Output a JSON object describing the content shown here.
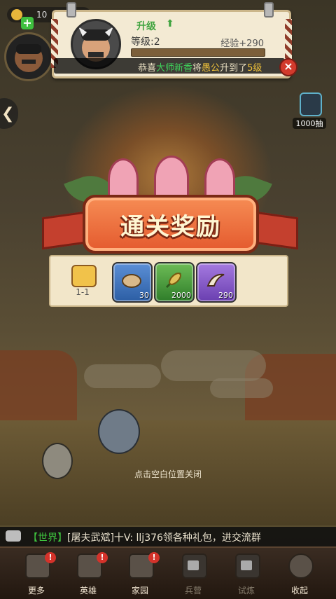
{
  "hud": {
    "resource_value": "10",
    "plus": "+"
  },
  "notice": {
    "title": "升级",
    "level": "等级:2",
    "exp": "经验+290",
    "ticker": {
      "prefix": "恭喜",
      "name": "大师新香",
      "mid": "将",
      "hero": "愚公",
      "suffix": "升到了",
      "level_part": "5级"
    },
    "close": "×"
  },
  "banner": {
    "title": "通关奖励"
  },
  "rewards": {
    "stage_label": "1-1",
    "items": [
      {
        "icon": "stone-icon",
        "count": "30",
        "color": "blue"
      },
      {
        "icon": "grain-icon",
        "count": "2000",
        "color": "green"
      },
      {
        "icon": "horn-icon",
        "count": "290",
        "color": "purple"
      }
    ]
  },
  "draw_button": {
    "label": "1000抽"
  },
  "hint": "点击空白位置关闭",
  "chat": {
    "channel": "【世界】",
    "message": "[屠夫武斌]十V: llj376领各种礼包，进交流群"
  },
  "bottom_nav": {
    "items": [
      {
        "label": "更多",
        "badge": "!",
        "locked": false
      },
      {
        "label": "英雄",
        "badge": "!",
        "locked": false
      },
      {
        "label": "家园",
        "badge": "!",
        "locked": false
      },
      {
        "label": "兵营",
        "badge": "",
        "locked": true
      },
      {
        "label": "试炼",
        "badge": "",
        "locked": true
      },
      {
        "label": "收起",
        "badge": "",
        "locked": false
      }
    ]
  }
}
